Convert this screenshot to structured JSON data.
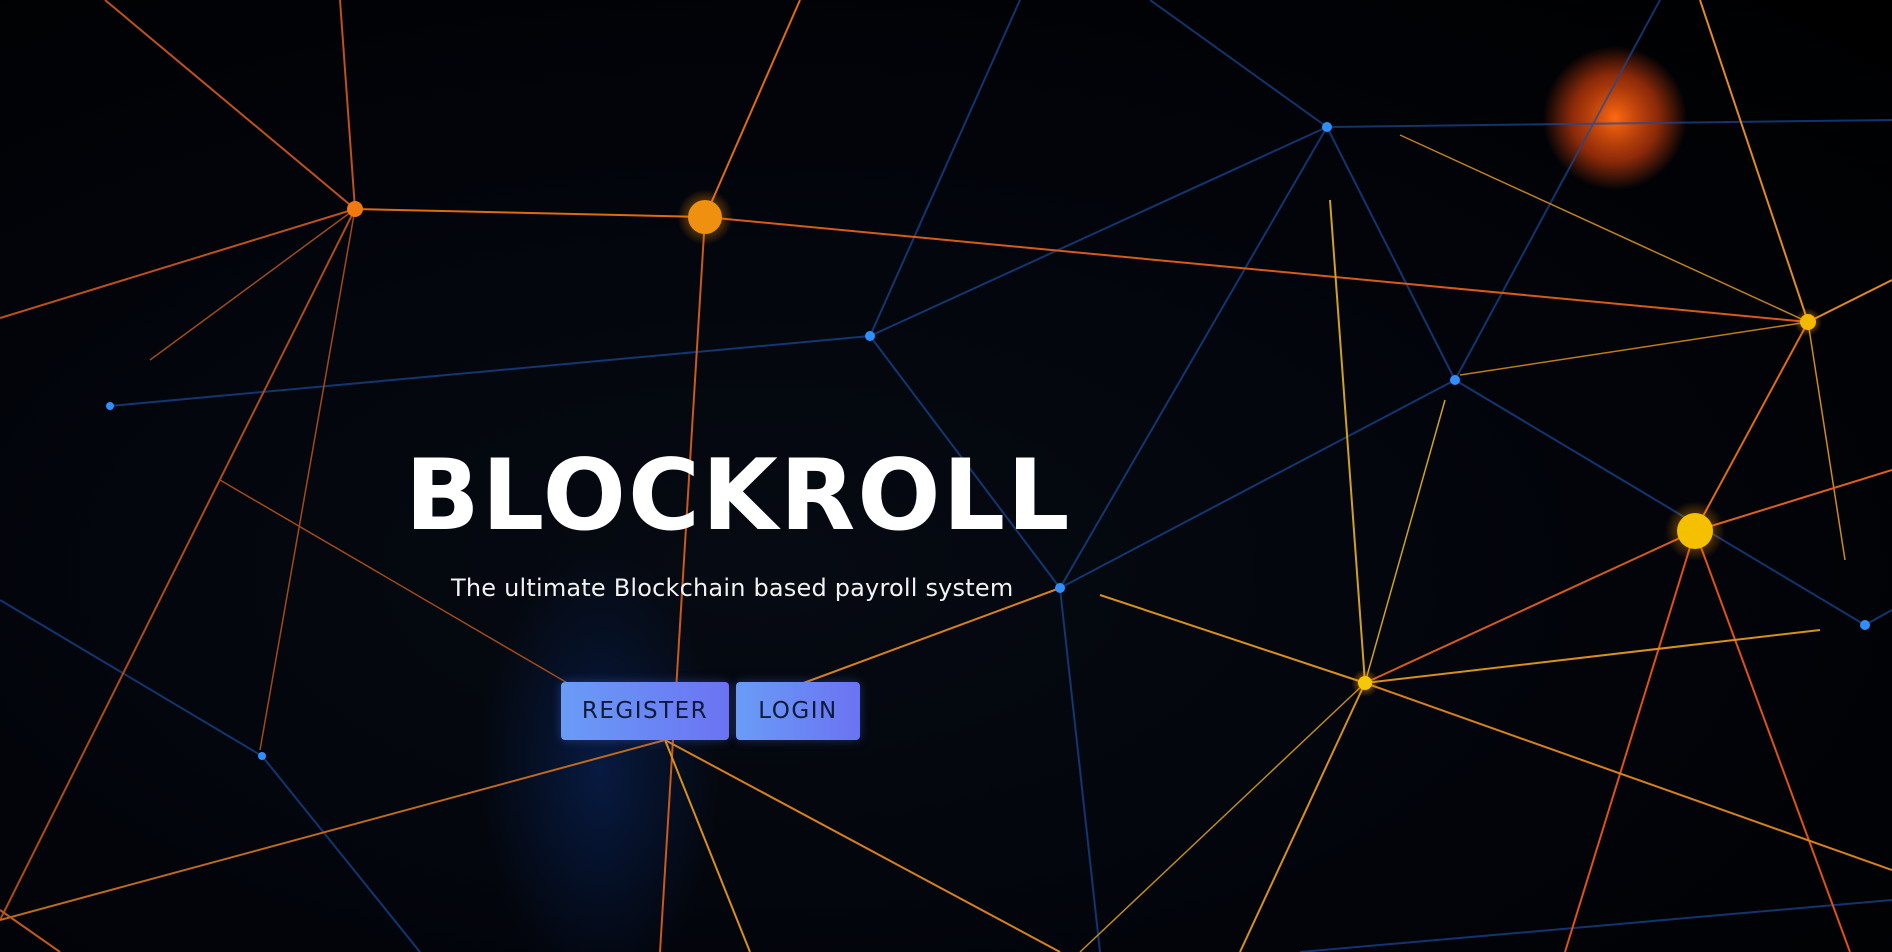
{
  "hero": {
    "title": "BLOCKROLL",
    "tagline": "The ultimate Blockchain based payroll system"
  },
  "actions": {
    "register_label": "REGISTER",
    "login_label": "LOGIN"
  },
  "colors": {
    "background": "#000000",
    "node_orange": "#f08a10",
    "node_yellow": "#f5c000",
    "node_blue": "#2f8fff",
    "button_gradient_start": "#6a9cf6",
    "button_gradient_end": "#6b73f2"
  }
}
